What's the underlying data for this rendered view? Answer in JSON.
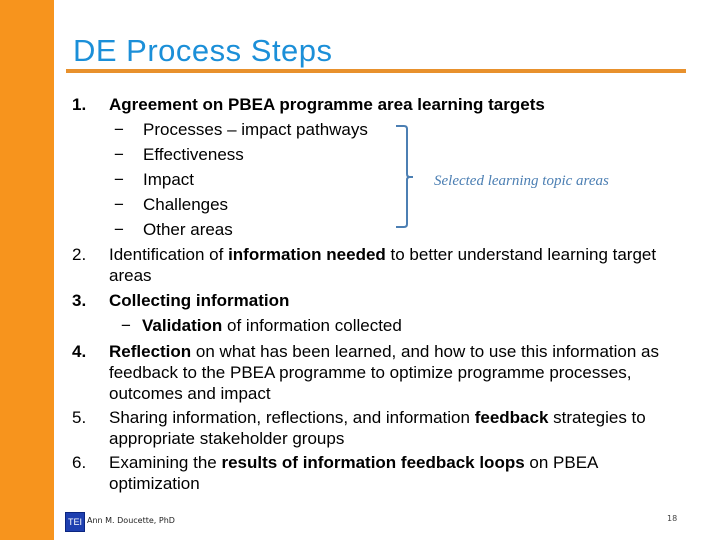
{
  "slide": {
    "title": "DE Process Steps",
    "colors": {
      "sidebar": "#F7941D",
      "title": "#1B8FD8",
      "rule": "#E8912D",
      "callout": "#4C7FB3"
    },
    "steps": [
      {
        "num": "1.",
        "parts": [
          {
            "text": "Agreement on PBEA programme area learning targets",
            "bold": true
          }
        ],
        "subitems": [
          "Processes – impact pathways",
          "Effectiveness",
          "Impact",
          "Challenges",
          "Other areas"
        ]
      },
      {
        "num": "2.",
        "parts": [
          {
            "text": "Identification of ",
            "bold": false
          },
          {
            "text": "information needed",
            "bold": true
          },
          {
            "text": " to better understand learning target areas",
            "bold": false
          }
        ]
      },
      {
        "num": "3.",
        "parts": [
          {
            "text": "Collecting information",
            "bold": true
          }
        ],
        "subitems_rich": [
          [
            {
              "text": "Validation",
              "bold": true
            },
            {
              "text": " of information collected",
              "bold": false
            }
          ]
        ]
      },
      {
        "num": "4.",
        "parts": [
          {
            "text": "Reflection",
            "bold": true
          },
          {
            "text": " on what has been learned, and how to use this information as feedback to the PBEA programme to optimize programme processes, outcomes and impact",
            "bold": false
          }
        ]
      },
      {
        "num": "5.",
        "parts": [
          {
            "text": "Sharing information, reflections, and information ",
            "bold": false
          },
          {
            "text": "feedback",
            "bold": true
          },
          {
            "text": " strategies to appropriate stakeholder groups",
            "bold": false
          }
        ]
      },
      {
        "num": "6.",
        "parts": [
          {
            "text": "Examining the ",
            "bold": false
          },
          {
            "text": "results of  information feedback loops",
            "bold": true
          },
          {
            "text": " on PBEA optimization",
            "bold": false
          }
        ]
      }
    ],
    "callout": "Selected learning topic areas",
    "footer": {
      "logo_text": "TEI",
      "author": "Ann M. Doucette, PhD",
      "page_number": "18"
    }
  }
}
